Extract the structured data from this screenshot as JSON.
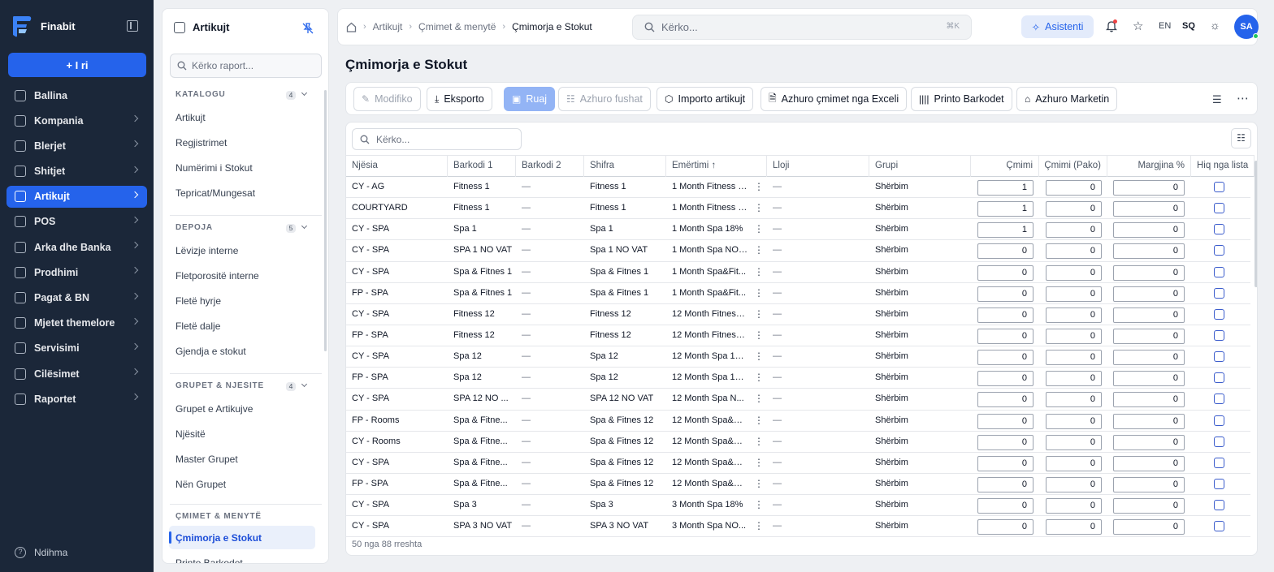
{
  "brand": {
    "name": "Finabit"
  },
  "nav": {
    "new_button": "+ I ri",
    "items": [
      {
        "label": "Ballina",
        "icon": "dashboard-icon"
      },
      {
        "label": "Kompania",
        "icon": "building-icon"
      },
      {
        "label": "Blerjet",
        "icon": "truck-icon"
      },
      {
        "label": "Shitjet",
        "icon": "store-icon"
      },
      {
        "label": "Artikujt",
        "icon": "box-icon",
        "active": true
      },
      {
        "label": "POS",
        "icon": "register-icon"
      },
      {
        "label": "Arka dhe Banka",
        "icon": "bank-icon"
      },
      {
        "label": "Prodhimi",
        "icon": "factory-icon"
      },
      {
        "label": "Pagat & BN",
        "icon": "coins-icon"
      },
      {
        "label": "Mjetet themelore",
        "icon": "asset-icon"
      },
      {
        "label": "Servisimi",
        "icon": "wrench-icon"
      },
      {
        "label": "Cilësimet",
        "icon": "settings-icon"
      },
      {
        "label": "Raportet",
        "icon": "bar-chart-icon"
      }
    ],
    "help": "Ndihma"
  },
  "panel": {
    "title": "Artikujt",
    "search_placeholder": "Kërko raport...",
    "sections": [
      {
        "title": "KATALOGU",
        "count": "4",
        "items": [
          "Artikujt",
          "Regjistrimet",
          "Numërimi i Stokut",
          "Tepricat/Mungesat"
        ]
      },
      {
        "title": "DEPOJA",
        "count": "5",
        "items": [
          "Lëvizje interne",
          "Fletporositë interne",
          "Fletë hyrje",
          "Fletë dalje",
          "Gjendja e stokut"
        ]
      },
      {
        "title": "GRUPET & NJESITE",
        "count": "4",
        "items": [
          "Grupet e Artikujve",
          "Njësitë",
          "Master Grupet",
          "Nën Grupet"
        ]
      },
      {
        "title": "ÇMIMET & MENYTË",
        "count": "",
        "items": [
          "Çmimorja e Stokut",
          "Printo Barkodet"
        ]
      }
    ]
  },
  "topbar": {
    "breadcrumb": [
      "Artikujt",
      "Çmimet & menytë",
      "Çmimorja e Stokut"
    ],
    "search_placeholder": "Kërko...",
    "search_shortcut": "⌘K",
    "assistant": "Asistenti",
    "lang_en": "EN",
    "lang_sq": "SQ",
    "avatar": "SA"
  },
  "page": {
    "title": "Çmimorja e Stokut"
  },
  "toolbar": {
    "edit": "Modifiko",
    "export": "Eksporto",
    "save": "Ruaj",
    "update_fields": "Azhuro fushat",
    "import": "Importo artikujt",
    "update_excel": "Azhuro çmimet nga Exceli",
    "print_barcodes": "Printo Barkodet",
    "update_market": "Azhuro Marketin"
  },
  "grid": {
    "search_placeholder": "Kërko...",
    "columns": [
      "Njësia",
      "Barkodi 1",
      "Barkodi 2",
      "Shifra",
      "Emërtimi ↑",
      "Lloji",
      "Grupi",
      "Çmimi",
      "Çmimi (Pako)",
      "Margjina %",
      "Hiq nga lista"
    ],
    "rows": [
      [
        "CY - AG",
        "Fitness 1",
        "—",
        "Fitness 1",
        "1 Month Fitness 1...",
        "—",
        "Shërbim",
        "1",
        "0",
        "0"
      ],
      [
        "COURTYARD",
        "Fitness 1",
        "—",
        "Fitness 1",
        "1 Month Fitness 1...",
        "—",
        "Shërbim",
        "1",
        "0",
        "0"
      ],
      [
        "CY - SPA",
        "Spa 1",
        "—",
        "Spa 1",
        "1 Month Spa 18%",
        "—",
        "Shërbim",
        "1",
        "0",
        "0"
      ],
      [
        "CY - SPA",
        "SPA 1 NO VAT",
        "—",
        "Spa 1 NO VAT",
        "1 Month Spa NO ...",
        "—",
        "Shërbim",
        "0",
        "0",
        "0"
      ],
      [
        "CY - SPA",
        "Spa & Fitnes 1",
        "—",
        "Spa & Fitnes 1",
        "1 Month Spa&Fit...",
        "—",
        "Shërbim",
        "0",
        "0",
        "0"
      ],
      [
        "FP - SPA",
        "Spa & Fitnes 1",
        "—",
        "Spa & Fitnes 1",
        "1 Month Spa&Fit...",
        "—",
        "Shërbim",
        "0",
        "0",
        "0"
      ],
      [
        "CY - SPA",
        "Fitness 12",
        "—",
        "Fitness 12",
        "12 Month Fitness...",
        "—",
        "Shërbim",
        "0",
        "0",
        "0"
      ],
      [
        "FP - SPA",
        "Fitness 12",
        "—",
        "Fitness 12",
        "12 Month Fitness...",
        "—",
        "Shërbim",
        "0",
        "0",
        "0"
      ],
      [
        "CY - SPA",
        "Spa 12",
        "—",
        "Spa 12",
        "12 Month Spa 18%",
        "—",
        "Shërbim",
        "0",
        "0",
        "0"
      ],
      [
        "FP - SPA",
        "Spa 12",
        "—",
        "Spa 12",
        "12 Month Spa 18%",
        "—",
        "Shërbim",
        "0",
        "0",
        "0"
      ],
      [
        "CY - SPA",
        "SPA 12 NO ...",
        "—",
        "SPA 12 NO VAT",
        "12 Month Spa N...",
        "—",
        "Shërbim",
        "0",
        "0",
        "0"
      ],
      [
        "FP - Rooms",
        "Spa & Fitne...",
        "—",
        "Spa & Fitnes 12",
        "12 Month Spa&Fi...",
        "—",
        "Shërbim",
        "0",
        "0",
        "0"
      ],
      [
        "CY - Rooms",
        "Spa & Fitne...",
        "—",
        "Spa & Fitnes 12",
        "12 Month Spa&Fi...",
        "—",
        "Shërbim",
        "0",
        "0",
        "0"
      ],
      [
        "CY - SPA",
        "Spa & Fitne...",
        "—",
        "Spa & Fitnes 12",
        "12 Month Spa&Fi...",
        "—",
        "Shërbim",
        "0",
        "0",
        "0"
      ],
      [
        "FP - SPA",
        "Spa & Fitne...",
        "—",
        "Spa & Fitnes 12",
        "12 Month Spa&Fi...",
        "—",
        "Shërbim",
        "0",
        "0",
        "0"
      ],
      [
        "CY - SPA",
        "Spa 3",
        "—",
        "Spa 3",
        "3 Month Spa 18%",
        "—",
        "Shërbim",
        "0",
        "0",
        "0"
      ],
      [
        "CY - SPA",
        "SPA 3 NO VAT",
        "—",
        "SPA 3 NO VAT",
        "3 Month Spa NO...",
        "—",
        "Shërbim",
        "0",
        "0",
        "0"
      ]
    ],
    "footer": "50 nga 88 rreshta"
  },
  "colors": {
    "accent": "#2563eb",
    "sidebar": "#1b2739",
    "notification": "#ef4444",
    "online": "#22c55e"
  }
}
